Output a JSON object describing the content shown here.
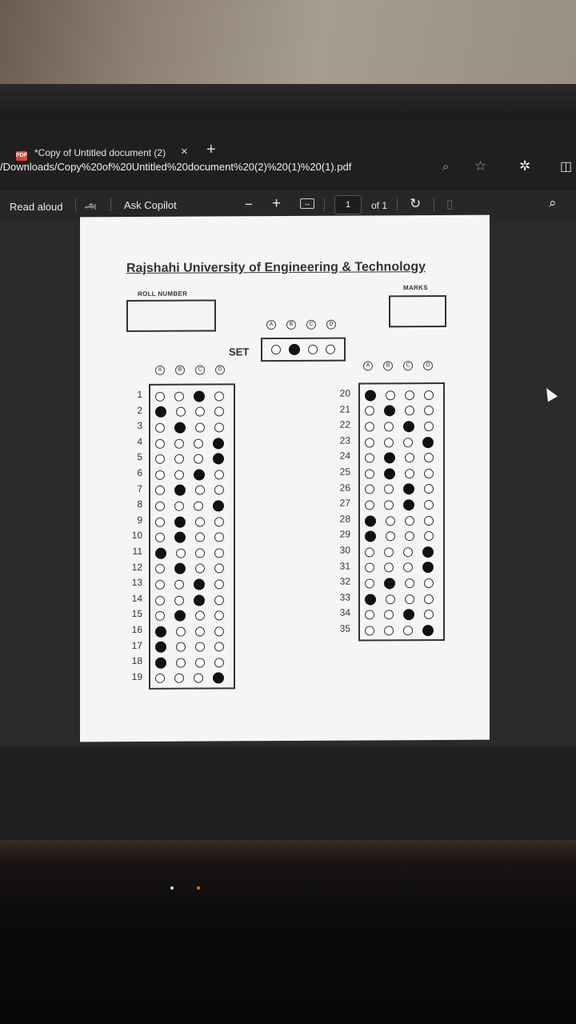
{
  "browser": {
    "tab_title": "*Copy of Untitled document (2)",
    "tab_close": "×",
    "new_tab": "+",
    "favicon": "PDF",
    "url": "/Downloads/Copy%20of%20Untitled%20document%20(2)%20(1)%20(1).pdf",
    "icons": [
      "zoom-icon",
      "favorite-star-icon",
      "extensions-icon",
      "split-screen-icon"
    ]
  },
  "toolbar": {
    "read_aloud": "Read aloud",
    "translate": "அ",
    "ask_copilot": "Ask Copilot",
    "zoom_out": "−",
    "zoom_in": "+",
    "page_current": "1",
    "page_of": "of 1"
  },
  "document": {
    "title": "Rajshahi University of Engineering & Technology",
    "roll_number_label": "ROLL NUMBER",
    "marks_label": "MARKS",
    "set_label": "SET",
    "option_letters": [
      "A",
      "B",
      "C",
      "D"
    ],
    "set_answer": 1,
    "left_column": {
      "numbers": [
        "1",
        "2",
        "3",
        "4",
        "5",
        "6",
        "7",
        "8",
        "9",
        "10",
        "11",
        "12",
        "13",
        "14",
        "15",
        "16",
        "17",
        "18",
        "19"
      ],
      "answers": [
        2,
        0,
        1,
        3,
        3,
        2,
        1,
        3,
        1,
        1,
        0,
        1,
        2,
        2,
        1,
        0,
        0,
        0,
        3
      ]
    },
    "right_column": {
      "numbers": [
        "20",
        "21",
        "22",
        "23",
        "24",
        "25",
        "26",
        "27",
        "28",
        "29",
        "30",
        "31",
        "32",
        "33",
        "34",
        "35"
      ],
      "answers": [
        0,
        1,
        2,
        3,
        1,
        1,
        2,
        2,
        0,
        0,
        3,
        3,
        1,
        0,
        2,
        3
      ]
    }
  }
}
